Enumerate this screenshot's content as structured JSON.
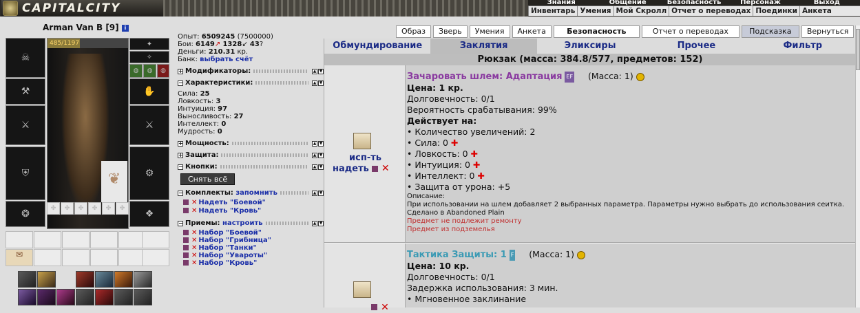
{
  "app": {
    "title": "CAPITALCITY"
  },
  "top_menu": {
    "row1": [
      "Знания",
      "Общение",
      "Безопасность",
      "Персонаж",
      "Выход"
    ],
    "row2": [
      "Инвентарь",
      "Умения",
      "Мой Скролл",
      "Отчет о переводах",
      "Поединки",
      "Анкета"
    ]
  },
  "character": {
    "name": "Arman Van B",
    "level": "[9]",
    "info_icon": "i",
    "hp": "485/1197",
    "hp_fraction": 0.405
  },
  "stats": {
    "exp_label": "Опыт:",
    "exp_value": "6509245",
    "exp_next": "(7500000)",
    "fights_label": "Бои:",
    "fights_wins": "6149",
    "fights_losses": "1328",
    "fights_draws": "43",
    "money_label": "Деньги:",
    "money_value": "210.31",
    "money_unit": "кр.",
    "bank_label": "Банк:",
    "bank_link": "выбрать счёт"
  },
  "sections": {
    "modifiers": "Модификаторы:",
    "characteristics": "Характеристики:",
    "power": "Мощность:",
    "defense": "Защита:",
    "buttons": "Кнопки:",
    "sets": "Комплекты:",
    "sets_link": "запомнить",
    "techniques": "Приемы:",
    "techniques_link": "настроить"
  },
  "characteristics": [
    {
      "label": "Сила:",
      "value": "25"
    },
    {
      "label": "Ловкость:",
      "value": "3"
    },
    {
      "label": "Интуиция:",
      "value": "97"
    },
    {
      "label": "Выносливость:",
      "value": "27"
    },
    {
      "label": "Интеллект:",
      "value": "0"
    },
    {
      "label": "Мудрость:",
      "value": "0"
    }
  ],
  "undress_button": "Снять всё",
  "sets": [
    "Надеть \"Боевой\"",
    "Надеть \"Кровь\""
  ],
  "techniques": [
    "Набор \"Боевой\"",
    "Набор \"Грибница\"",
    "Набор \"Танки\"",
    "Набор \"Увароты\"",
    "Набор \"Кровь\""
  ],
  "top_tabs": [
    {
      "label": "Образ"
    },
    {
      "label": "Зверь"
    },
    {
      "label": "Умения"
    },
    {
      "label": "Анкета"
    },
    {
      "label": "Безопасность"
    },
    {
      "label": "Отчет о переводах"
    },
    {
      "label": "Подсказка"
    },
    {
      "label": "Вернуться"
    }
  ],
  "nav_tabs": [
    "Обмундирование",
    "Заклятия",
    "Эликсиры",
    "Прочее",
    "Фильтр"
  ],
  "active_nav": "Заклятия",
  "backpack": "Рюкзак (масса: 384.8/577, предметов: 152)",
  "items": [
    {
      "name": "Зачаровать шлем: Адаптация",
      "tag": "EF",
      "mass": "(Масса: 1)",
      "price": "Цена: 1 кр.",
      "durability": "Долговечность: 0/1",
      "chance": "Вероятность срабатывания: 99%",
      "acts_on": "Действует на:",
      "effects": [
        {
          "text": "• Количество увеличений: 2",
          "plus": false
        },
        {
          "text": "• Сила: 0",
          "plus": true
        },
        {
          "text": "• Ловкость: 0",
          "plus": true
        },
        {
          "text": "• Интуиция: 0",
          "plus": true
        },
        {
          "text": "• Интеллект: 0",
          "plus": true
        },
        {
          "text": "• Защита от урона: +5",
          "plus": false
        }
      ],
      "desc_label": "Описание:",
      "desc": "При использовании на шлем добавляет 2 выбранных параметра. Параметры нужно выбрать до использования сеитка.",
      "made_in": "Сделано в Abandoned Plain",
      "note1": "Предмет не подлежит ремонту",
      "note2": "Предмет из подземелья",
      "action1": "исп-ть",
      "action2": "надеть"
    },
    {
      "name": "Тактика Защиты: 1",
      "tag": "F",
      "mass": "(Масса: 1)",
      "price": "Цена: 10 кр.",
      "durability": "Долговечность: 0/1",
      "delay": "Задержка использования: 3 мин.",
      "instant": "• Мгновенное заклинание"
    }
  ]
}
